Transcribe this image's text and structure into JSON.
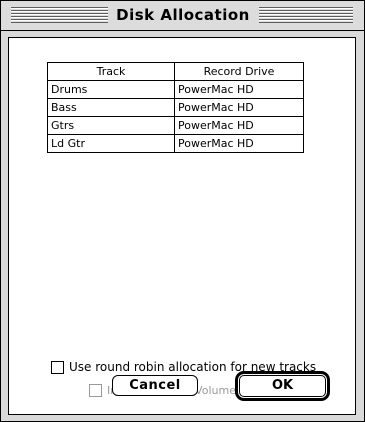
{
  "window": {
    "title": "Disk Allocation"
  },
  "table": {
    "headers": [
      "Track",
      "Record Drive"
    ],
    "rows": [
      [
        "Drums",
        "PowerMac HD"
      ],
      [
        "Bass",
        "PowerMac HD"
      ],
      [
        "Gtrs",
        "PowerMac HD"
      ],
      [
        "Ld Gtr",
        "PowerMac HD"
      ]
    ]
  },
  "options": {
    "round_robin_label": "Use round robin allocation for new tracks",
    "round_robin_checked": false,
    "include_system_label": "Include System Volume",
    "include_system_enabled": false
  },
  "buttons": {
    "cancel": "Cancel",
    "ok": "OK"
  }
}
